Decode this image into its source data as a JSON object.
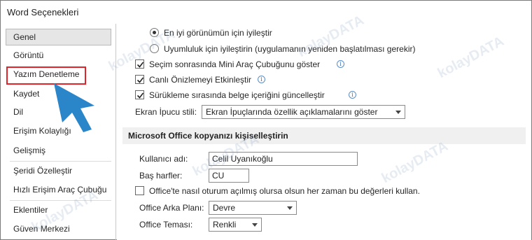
{
  "window": {
    "title": "Word Seçenekleri"
  },
  "sidebar": {
    "items": [
      {
        "label": "Genel",
        "selected": true
      },
      {
        "label": "Görüntü"
      },
      {
        "label": "Yazım Denetleme",
        "highlighted": true
      },
      {
        "label": "Kaydet"
      },
      {
        "label": "Dil"
      },
      {
        "label": "Erişim Kolaylığı"
      },
      {
        "label": "Gelişmiş"
      },
      {
        "label": "Şeridi Özelleştir"
      },
      {
        "label": "Hızlı Erişim Araç Çubuğu"
      },
      {
        "label": "Eklentiler"
      },
      {
        "label": "Güven Merkezi"
      }
    ]
  },
  "main": {
    "radio_best_appearance": {
      "label": "En iyi görünümün için iyileştir",
      "checked": true
    },
    "radio_compat": {
      "label": "Uyumluluk için iyileştirin (uygulamanın yeniden başlatılması gerekir)",
      "checked": false
    },
    "check_minitoolbar": {
      "label": "Seçim sonrasında Mini Araç Çubuğunu göster",
      "checked": true
    },
    "check_live_preview": {
      "label": "Canlı Önizlemeyi Etkinleştir",
      "checked": true
    },
    "check_drag_update": {
      "label": "Sürükleme sırasında belge içeriğini güncelleştir",
      "checked": true
    },
    "screentip": {
      "label": "Ekran İpucu stili:",
      "value": "Ekran İpuçlarında özellik açıklamalarını göster"
    },
    "personalize_header": "Microsoft Office kopyanızı kişiselleştirin",
    "username": {
      "label": "Kullanıcı adı:",
      "value": "Celil Uyanıkoğlu"
    },
    "initials": {
      "label": "Baş harfler:",
      "value": "CU"
    },
    "check_always_use": {
      "label": "Office'te nasıl oturum açılmış olursa olsun her zaman bu değerleri kullan.",
      "checked": false
    },
    "background": {
      "label": "Office Arka Planı:",
      "value": "Devre"
    },
    "theme": {
      "label": "Office Teması:",
      "value": "Renkli"
    }
  },
  "watermark": {
    "text": "kolayDATA"
  },
  "colors": {
    "highlight_border": "#e0242a",
    "cursor_arrow": "#2a86c9",
    "selected_item_bg": "#e6e6e6"
  }
}
